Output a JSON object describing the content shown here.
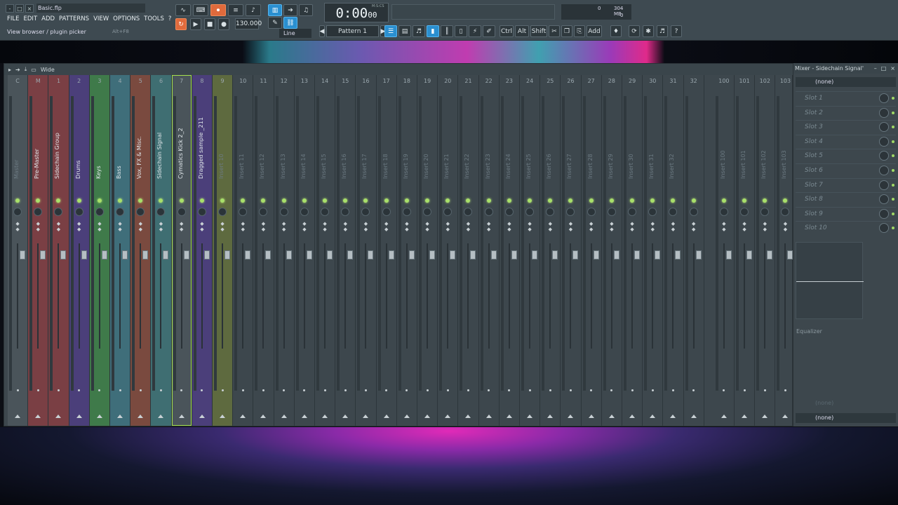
{
  "window": {
    "title": "Basic.flp",
    "controls": [
      "-",
      "□",
      "×"
    ]
  },
  "menu": [
    "FILE",
    "EDIT",
    "ADD",
    "PATTERNS",
    "VIEW",
    "OPTIONS",
    "TOOLS",
    "?"
  ],
  "hint": {
    "text": "View browser / plugin picker",
    "shortcut": "Alt+F8"
  },
  "transport": {
    "time": "0:00",
    "time_small": "00",
    "time_unit": "M:S:CS",
    "tempo": "130.000",
    "pattern": "Pattern 1",
    "snap": "Line"
  },
  "toolbar_buttons": [
    "Ctrl",
    "Alt",
    "Shift",
    "Add"
  ],
  "cpu": {
    "cpu": "0",
    "memory": "304 MB",
    "polyphony": "0"
  },
  "mixer": {
    "mode": "Wide",
    "tracks": [
      {
        "num": "C",
        "name": "Master",
        "color": "#4a545a",
        "dim": true
      },
      {
        "num": "M",
        "name": "Pre-Master",
        "color": "#7a3f44"
      },
      {
        "num": "1",
        "name": "Sidechain Group",
        "color": "#7a3f44"
      },
      {
        "num": "2",
        "name": "Drums",
        "color": "#4b3f7a"
      },
      {
        "num": "3",
        "name": "Keys",
        "color": "#3f7a4a"
      },
      {
        "num": "4",
        "name": "Bass",
        "color": "#3f6e7a"
      },
      {
        "num": "5",
        "name": "Vox, FX & Misc.",
        "color": "#7a4a3f"
      },
      {
        "num": "6",
        "name": "Sidechain Signal",
        "color": "#3f6e72"
      },
      {
        "num": "7",
        "name": "Cymatics Kick 2_2",
        "color": "#4a545a",
        "selected": true
      },
      {
        "num": "8",
        "name": "Dragged sample _211",
        "color": "#4b3f7a"
      },
      {
        "num": "9",
        "name": "Insert 10",
        "color": "#5e6a3f",
        "dim": true
      },
      {
        "num": "10",
        "name": "Insert 11",
        "dim": true
      },
      {
        "num": "11",
        "name": "Insert 12",
        "dim": true
      },
      {
        "num": "12",
        "name": "Insert 13",
        "dim": true
      },
      {
        "num": "13",
        "name": "Insert 14",
        "dim": true
      },
      {
        "num": "14",
        "name": "Insert 15",
        "dim": true
      },
      {
        "num": "15",
        "name": "Insert 16",
        "dim": true
      },
      {
        "num": "16",
        "name": "Insert 17",
        "dim": true
      },
      {
        "num": "17",
        "name": "Insert 18",
        "dim": true
      },
      {
        "num": "18",
        "name": "Insert 19",
        "dim": true
      },
      {
        "num": "19",
        "name": "Insert 20",
        "dim": true
      },
      {
        "num": "20",
        "name": "Insert 21",
        "dim": true
      },
      {
        "num": "21",
        "name": "Insert 22",
        "dim": true
      },
      {
        "num": "22",
        "name": "Insert 23",
        "dim": true
      },
      {
        "num": "23",
        "name": "Insert 24",
        "dim": true
      },
      {
        "num": "24",
        "name": "Insert 25",
        "dim": true
      },
      {
        "num": "25",
        "name": "Insert 26",
        "dim": true
      },
      {
        "num": "26",
        "name": "Insert 27",
        "dim": true
      },
      {
        "num": "27",
        "name": "Insert 28",
        "dim": true
      },
      {
        "num": "28",
        "name": "Insert 29",
        "dim": true
      },
      {
        "num": "29",
        "name": "Insert 30",
        "dim": true
      },
      {
        "num": "30",
        "name": "Insert 31",
        "dim": true
      },
      {
        "num": "31",
        "name": "Insert 32",
        "dim": true
      },
      {
        "num": "32",
        "name": "",
        "dim": true
      },
      {
        "num": "100",
        "name": "Insert 100",
        "dim": true
      },
      {
        "num": "101",
        "name": "Insert 101",
        "dim": true
      },
      {
        "num": "102",
        "name": "Insert 102",
        "dim": true
      },
      {
        "num": "103",
        "name": "Insert 103",
        "dim": true
      }
    ]
  },
  "side_panel": {
    "title": "Mixer - Sidechain Signal'",
    "input": "(none)",
    "slots": [
      "Slot 1",
      "Slot 2",
      "Slot 3",
      "Slot 4",
      "Slot 5",
      "Slot 6",
      "Slot 7",
      "Slot 8",
      "Slot 9",
      "Slot 10"
    ],
    "eq_label": "Equalizer",
    "send_label": "(none)",
    "output": "(none)"
  }
}
